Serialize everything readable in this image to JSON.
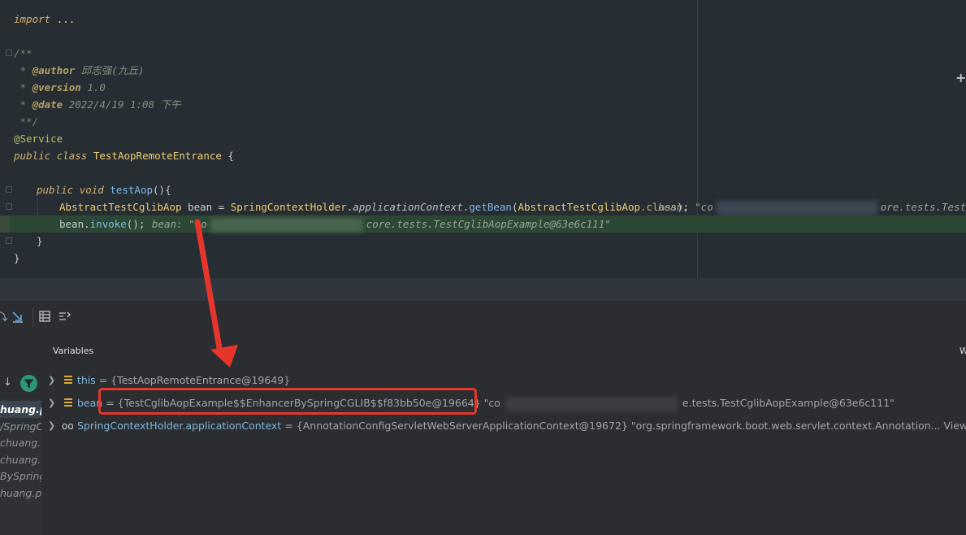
{
  "editor": {
    "lines": [
      {
        "import_kw": "import",
        "import_dots": "..."
      },
      {},
      {
        "doc_open": "/**"
      },
      {
        "doc_star": " * ",
        "tag": "@author",
        "val": " 邱志强(九丘)"
      },
      {
        "doc_star": " * ",
        "tag": "@version",
        "val": " 1.0"
      },
      {
        "doc_star": " * ",
        "tag": "@date",
        "val": " 2022/4/19 1:08 下午"
      },
      {
        "doc_close": " **/"
      },
      {
        "annotation": "@Service"
      },
      {
        "kw1": "public",
        "kw2": "class",
        "name": "TestAopRemoteEntrance",
        "brace": " {"
      },
      {},
      {
        "kw1": "public",
        "kw2": "void",
        "name": "testAop",
        "brace": "(){"
      },
      {
        "type": "AbstractTestCglibAop",
        "var": " bean = ",
        "holder": "SpringContextHolder",
        "dot": ".",
        "field": "applicationContext",
        "dot2": ".",
        "method": "getBean",
        "arg_open": "(",
        "arg": "AbstractTestCglibAop",
        "arg_kw": ".class",
        "arg_close": ");",
        "hint1": "bean: \"co",
        "hint2": "ore.tests.TestC"
      },
      {
        "call": "bean.",
        "method": "invoke",
        "tail": "();",
        "hint1": "bean: \"co",
        "hint2": "core.tests.TestCglibAopExample@63e6c111\""
      },
      {
        "brace": "}"
      },
      {
        "brace": "}"
      }
    ]
  },
  "debugger": {
    "variables_title": "Variables",
    "right_label": "W",
    "frames": [
      {
        "label": "huang.pu"
      },
      {
        "label": "/SpringC"
      },
      {
        "label": "chuang."
      },
      {
        "label": "chuang."
      },
      {
        "label": "BySpring"
      },
      {
        "label": "huang.pu"
      }
    ],
    "variables": [
      {
        "name": "this",
        "value": " = {TestAopRemoteEntrance@19649}"
      },
      {
        "name": "bean",
        "value": " = {TestCglibAopExample$$EnhancerBySpringCGLIB$$f83bb50e@19664} \"co",
        "value_tail": "e.tests.TestCglibAopExample@63e6c111\""
      },
      {
        "name": "SpringContextHolder.applicationContext",
        "value": " = {AnnotationConfigServletWebServerApplicationContext@19672} \"org.springframework.boot.web.servlet.context.Annotation...",
        "view": "View"
      }
    ]
  },
  "colors": {
    "editor_bg": "#262d33",
    "exec_line": "#2c4733",
    "accent_filter": "#2d9676",
    "highlight_box": "#e6362b"
  },
  "icons": [
    "fold-icon",
    "step-into-icon",
    "table-icon",
    "format-icon",
    "down-arrow-icon",
    "filter-icon",
    "field-icon",
    "watch-icon",
    "plus-icon",
    "chevron-right-icon"
  ]
}
